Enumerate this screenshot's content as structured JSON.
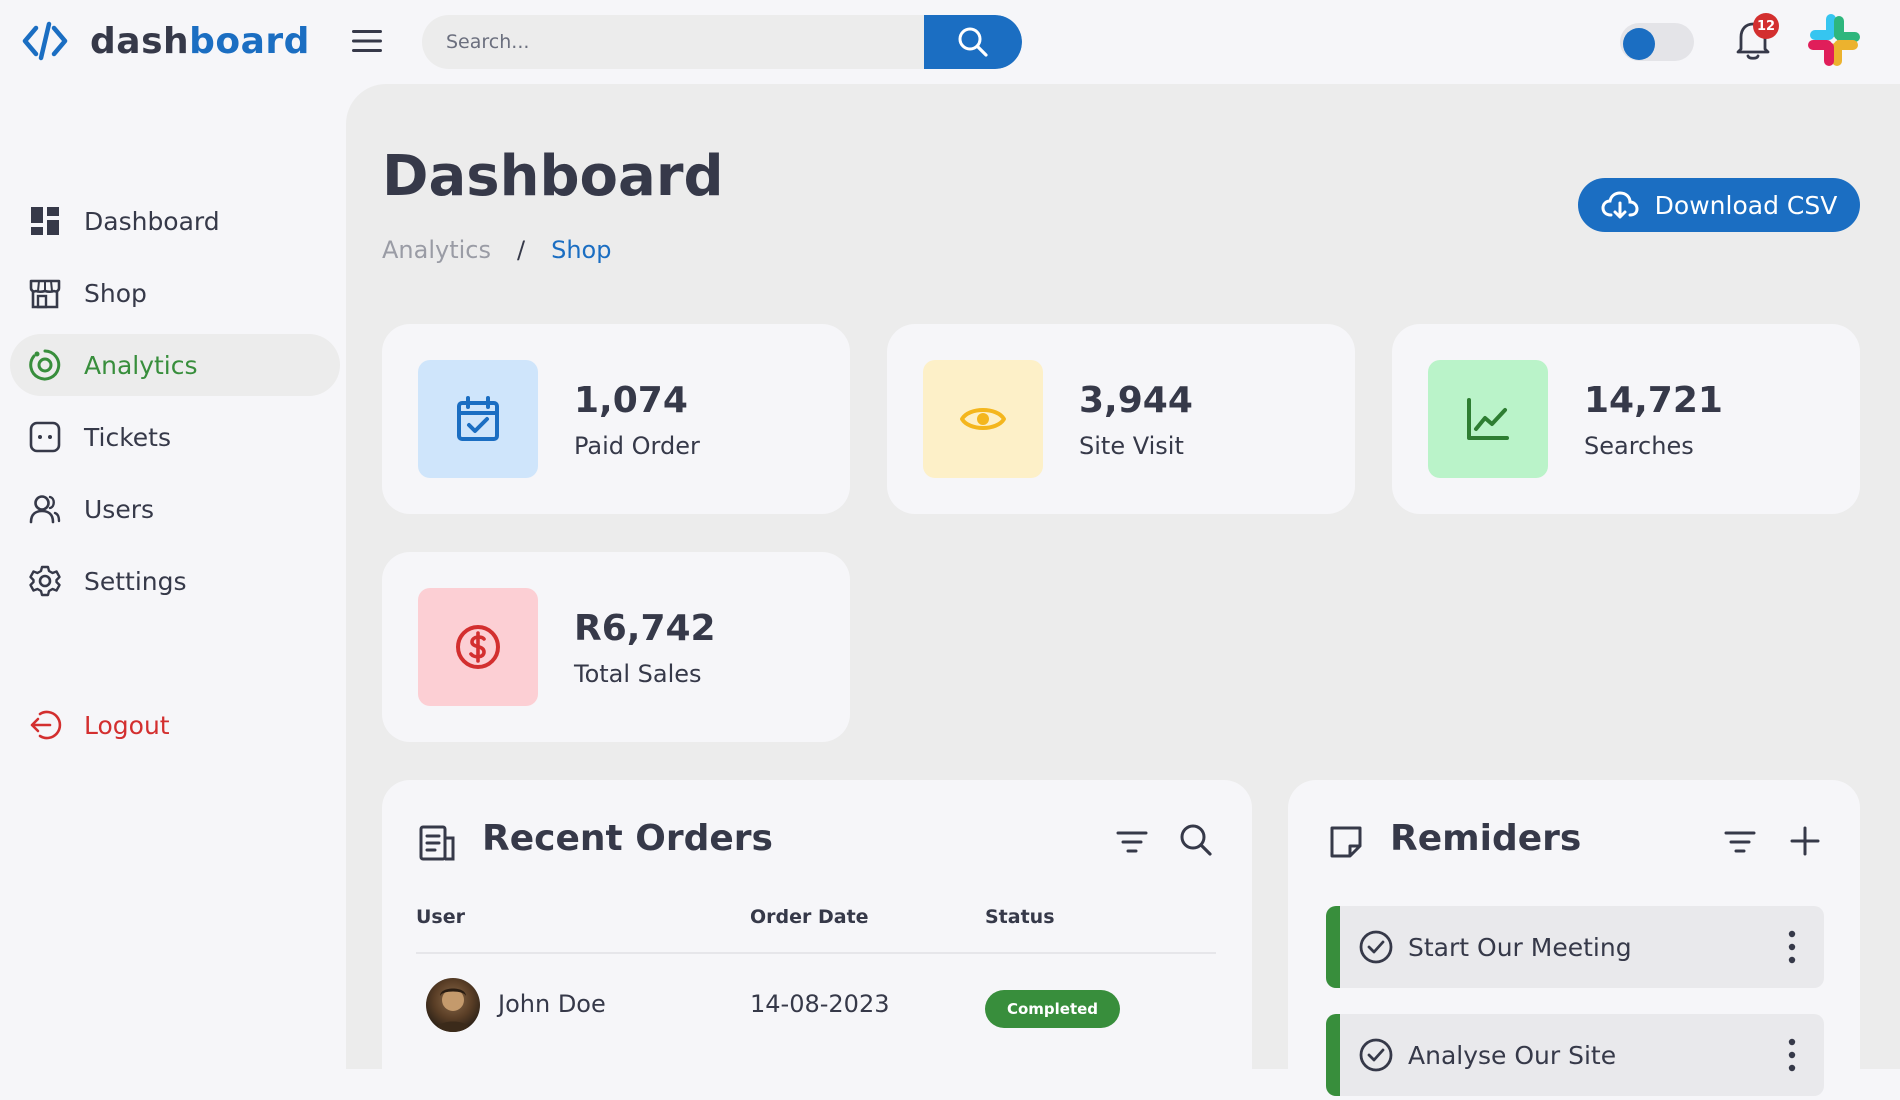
{
  "app": {
    "name_part1": "dash",
    "name_part2": "board"
  },
  "search": {
    "placeholder": "Search..."
  },
  "notifications": {
    "count": "12"
  },
  "theme_toggle": {
    "state": "light"
  },
  "sidebar": {
    "items": [
      {
        "label": "Dashboard",
        "icon": "grid-icon"
      },
      {
        "label": "Shop",
        "icon": "store-icon"
      },
      {
        "label": "Analytics",
        "icon": "analytics-icon",
        "active": true
      },
      {
        "label": "Tickets",
        "icon": "ticket-icon"
      },
      {
        "label": "Users",
        "icon": "users-icon"
      },
      {
        "label": "Settings",
        "icon": "gear-icon"
      }
    ],
    "logout": {
      "label": "Logout",
      "icon": "logout-icon"
    }
  },
  "header": {
    "title": "Dashboard",
    "breadcrumb": [
      "Analytics",
      "/",
      "Shop"
    ],
    "download_label": "Download CSV"
  },
  "stats": [
    {
      "value": "1,074",
      "label": "Paid Order",
      "icon": "calendar-check-icon",
      "color": "#1b6ec2",
      "bg": "#cfe5fb"
    },
    {
      "value": "3,944",
      "label": "Site Visit",
      "icon": "eye-icon",
      "color": "#f4b61d",
      "bg": "#fdf0c8"
    },
    {
      "value": "14,721",
      "label": "Searches",
      "icon": "trend-icon",
      "color": "#2e7d32",
      "bg": "#baf3c9"
    },
    {
      "value": "R6,742",
      "label": "Total Sales",
      "icon": "dollar-icon",
      "color": "#d32f2f",
      "bg": "#fccfd4"
    }
  ],
  "recent_orders": {
    "title": "Recent Orders",
    "columns": [
      "User",
      "Order Date",
      "Status"
    ],
    "rows": [
      {
        "user": "John Doe",
        "date": "14-08-2023",
        "status": "Completed"
      }
    ]
  },
  "reminders": {
    "title": "Remiders",
    "items": [
      "Start Our Meeting",
      "Analyse Our Site"
    ]
  },
  "colors": {
    "primary": "#1b6ec2",
    "success": "#388e3c",
    "danger": "#d32f2f",
    "text": "#363949"
  }
}
